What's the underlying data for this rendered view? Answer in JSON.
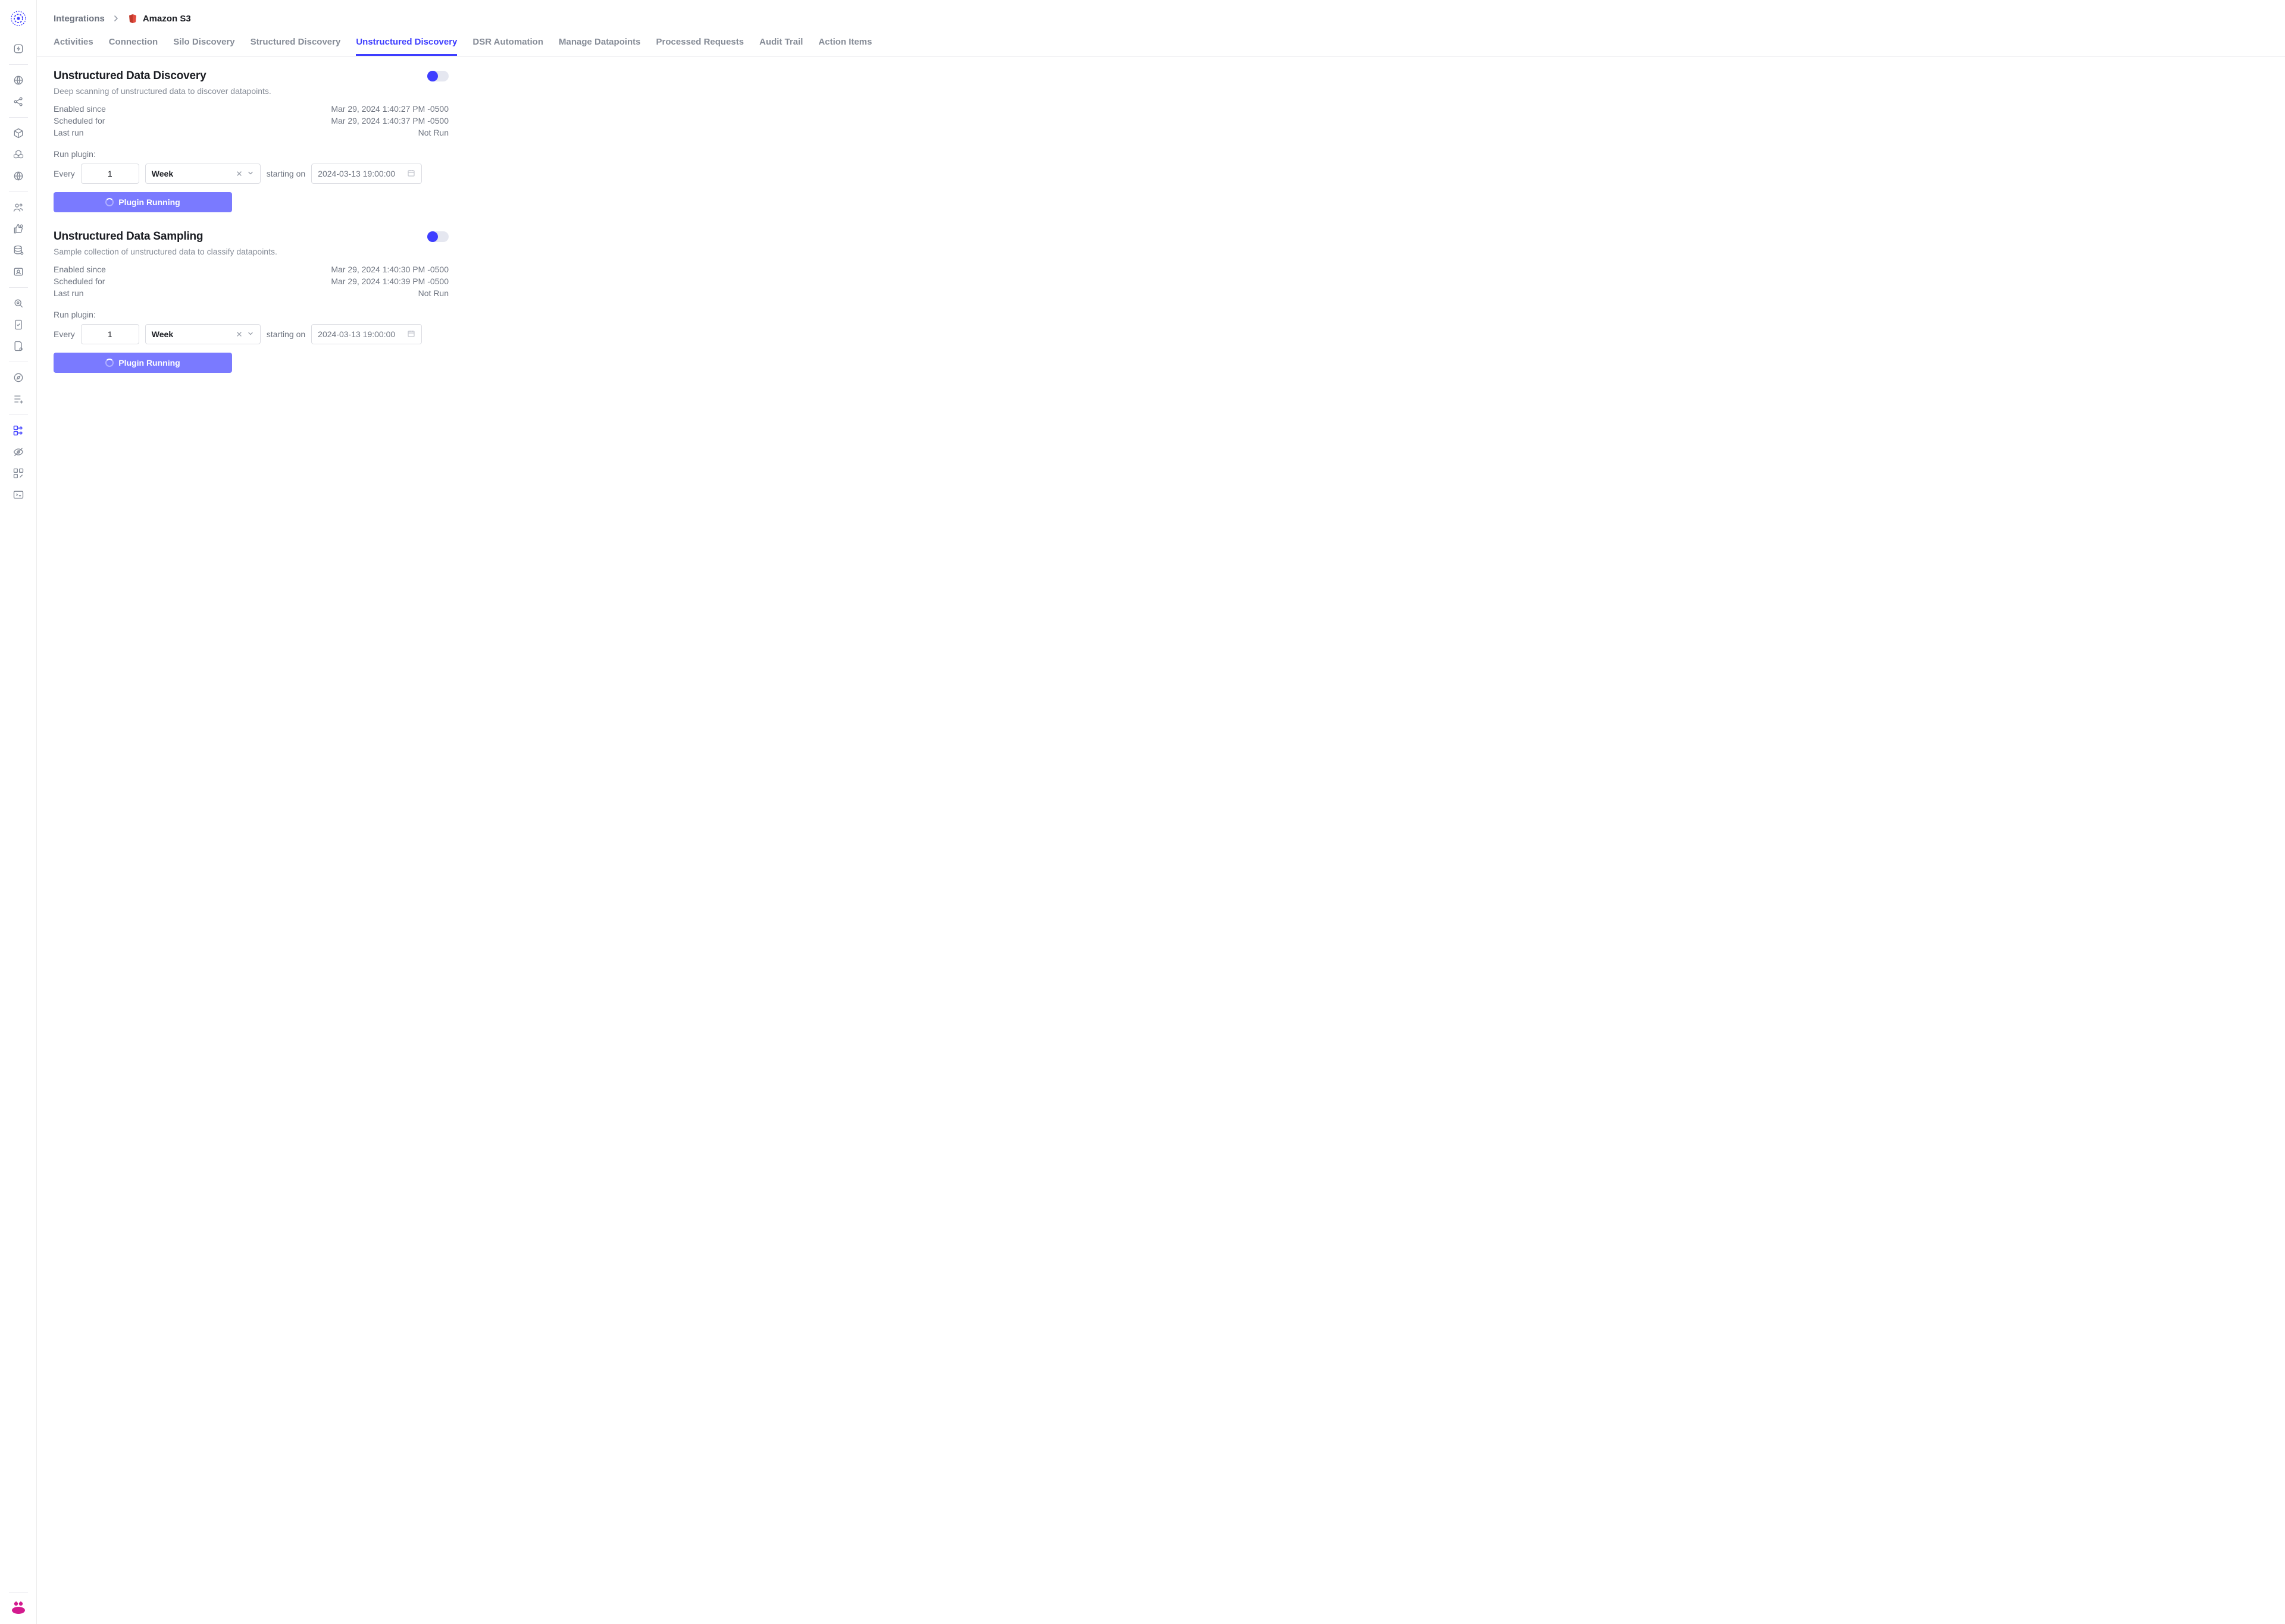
{
  "breadcrumb": {
    "root": "Integrations",
    "current": "Amazon S3"
  },
  "tabs": {
    "activities": "Activities",
    "connection": "Connection",
    "silo": "Silo Discovery",
    "structured": "Structured Discovery",
    "unstructured": "Unstructured Discovery",
    "dsr": "DSR Automation",
    "manage": "Manage Datapoints",
    "processed": "Processed Requests",
    "audit": "Audit Trail",
    "action": "Action Items"
  },
  "sections": [
    {
      "title": "Unstructured Data Discovery",
      "desc": "Deep scanning of unstructured data to discover datapoints.",
      "meta": {
        "enabled_lbl": "Enabled since",
        "enabled_val": "Mar 29, 2024 1:40:27 PM -0500",
        "scheduled_lbl": "Scheduled for",
        "scheduled_val": "Mar 29, 2024 1:40:37 PM -0500",
        "last_lbl": "Last run",
        "last_val": "Not Run"
      },
      "schedule": {
        "run_label": "Run plugin:",
        "every_lbl": "Every",
        "every_val": "1",
        "unit": "Week",
        "start_lbl": "starting on",
        "start_val": "2024-03-13 19:00:00"
      },
      "button": "Plugin Running"
    },
    {
      "title": "Unstructured Data Sampling",
      "desc": "Sample collection of unstructured data to classify datapoints.",
      "meta": {
        "enabled_lbl": "Enabled since",
        "enabled_val": "Mar 29, 2024 1:40:30 PM -0500",
        "scheduled_lbl": "Scheduled for",
        "scheduled_val": "Mar 29, 2024 1:40:39 PM -0500",
        "last_lbl": "Last run",
        "last_val": "Not Run"
      },
      "schedule": {
        "run_label": "Run plugin:",
        "every_lbl": "Every",
        "every_val": "1",
        "unit": "Week",
        "start_lbl": "starting on",
        "start_val": "2024-03-13 19:00:00"
      },
      "button": "Plugin Running"
    }
  ]
}
